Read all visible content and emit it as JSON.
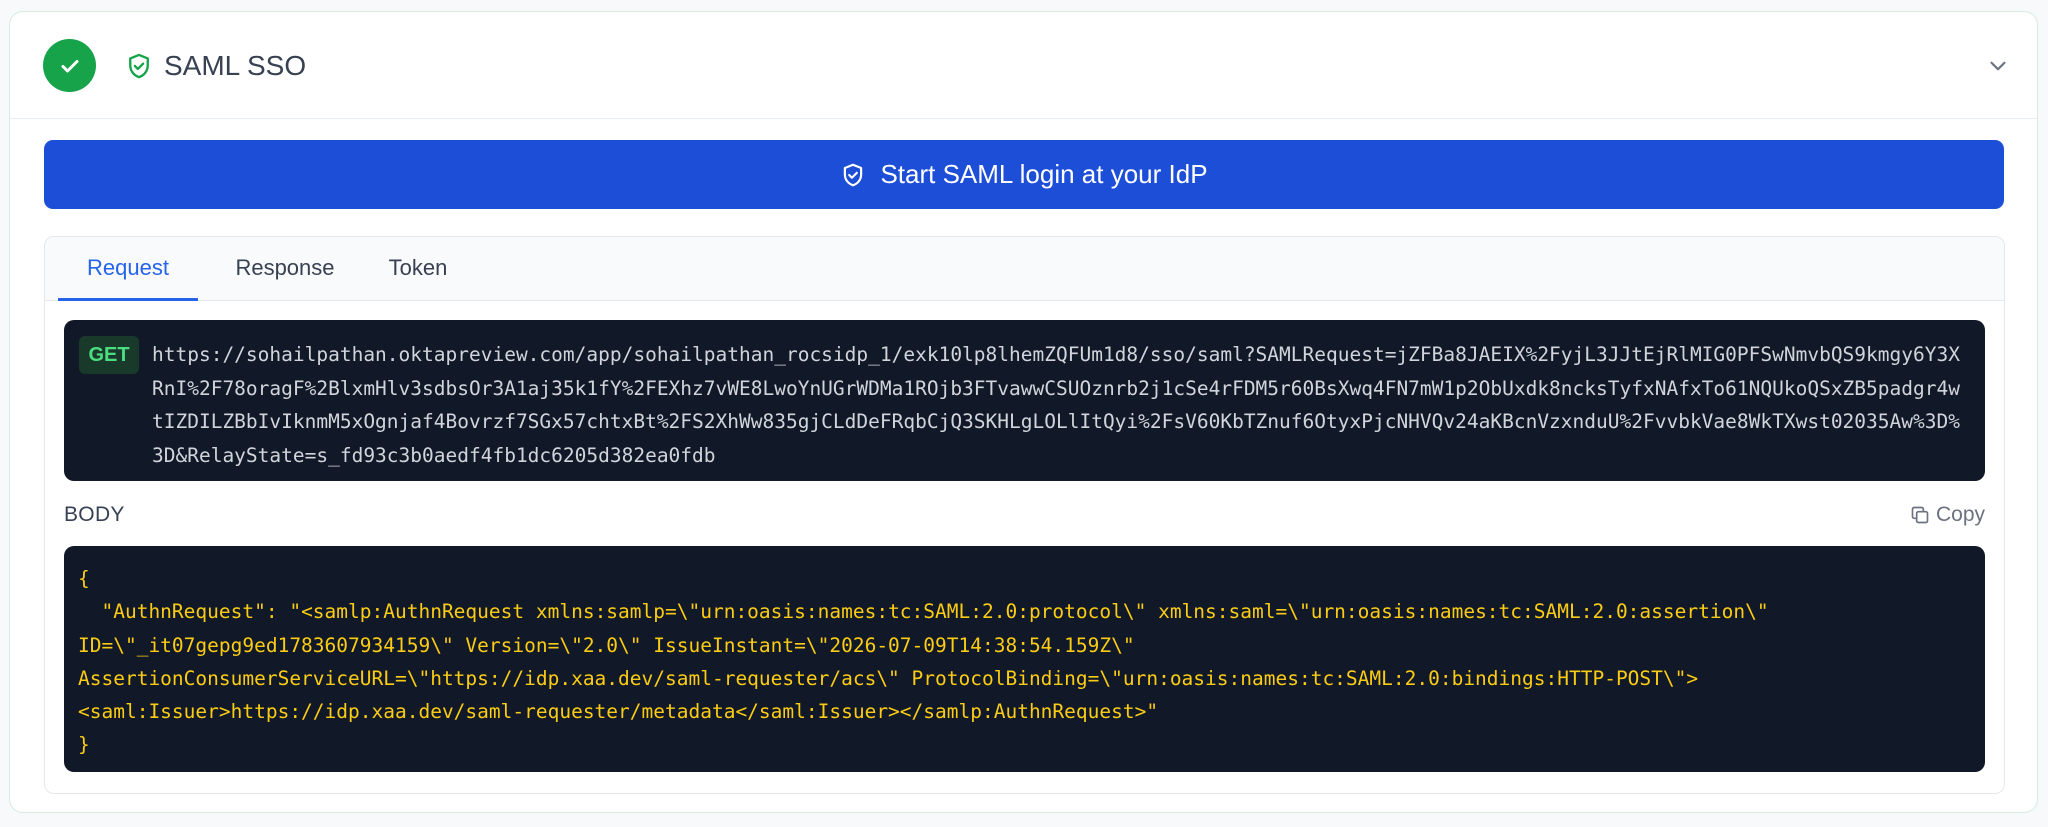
{
  "card": {
    "title": "SAML SSO"
  },
  "start_button": {
    "label": "Start SAML login at your IdP"
  },
  "tabs": [
    {
      "label": "Request",
      "active": true
    },
    {
      "label": "Response",
      "active": false
    },
    {
      "label": "Token",
      "active": false
    }
  ],
  "request": {
    "method": "GET",
    "url": "https://sohailpathan.oktapreview.com/app/sohailpathan_rocsidp_1/exk10lp8lhemZQFUm1d8/sso/saml?SAMLRequest=jZFBa8JAEIX%2FyjL3JJtEjRlMIG0PFSwNmvbQS9kmgy6Y3XRnI%2F78oragF%2BlxmHlv3sdbsOr3A1aj35k1fY%2FEXhz7vWE8LwoYnUGrWDMa1ROjb3FTvawwCSUOznrb2j1cSe4rFDM5r60BsXwq4FN7mW1p2ObUxdk8ncksTyfxNAfxTo61NQUkoQSxZB5padgr4wtIZDILZBbIvIknmM5xOgnjaf4Bovrzf7SGx57chtxBt%2FS2XhWw835gjCLdDeFRqbCjQ3SKHLgLOLlItQyi%2FsV60KbTZnuf6OtyxPjcNHVQv24aKBcnVzxnduU%2FvvbkVae8WkTXwst02035Aw%3D%3D&RelayState=s_fd93c3b0aedf4fb1dc6205d382ea0fdb",
    "body_label": "BODY",
    "copy_label": "Copy",
    "body": "{\n  \"AuthnRequest\": \"<samlp:AuthnRequest xmlns:samlp=\\\"urn:oasis:names:tc:SAML:2.0:protocol\\\" xmlns:saml=\\\"urn:oasis:names:tc:SAML:2.0:assertion\\\"\nID=\\\"_it07gepg9ed1783607934159\\\" Version=\\\"2.0\\\" IssueInstant=\\\"2026-07-09T14:38:54.159Z\\\"\nAssertionConsumerServiceURL=\\\"https://idp.xaa.dev/saml-requester/acs\\\" ProtocolBinding=\\\"urn:oasis:names:tc:SAML:2.0:bindings:HTTP-POST\\\">\n<saml:Issuer>https://idp.xaa.dev/saml-requester/metadata</saml:Issuer></samlp:AuthnRequest>\"\n}"
  },
  "colors": {
    "success": "#16a34a",
    "primary": "#1d4ed8",
    "tab_active": "#2563eb",
    "code_bg": "#111827",
    "code_text": "#facc15",
    "method_text": "#4ade80"
  },
  "icons": {
    "status": "check-icon",
    "type": "shield-check-icon",
    "toggle": "chevron-down-icon",
    "button": "shield-check-icon",
    "copy": "copy-icon"
  }
}
